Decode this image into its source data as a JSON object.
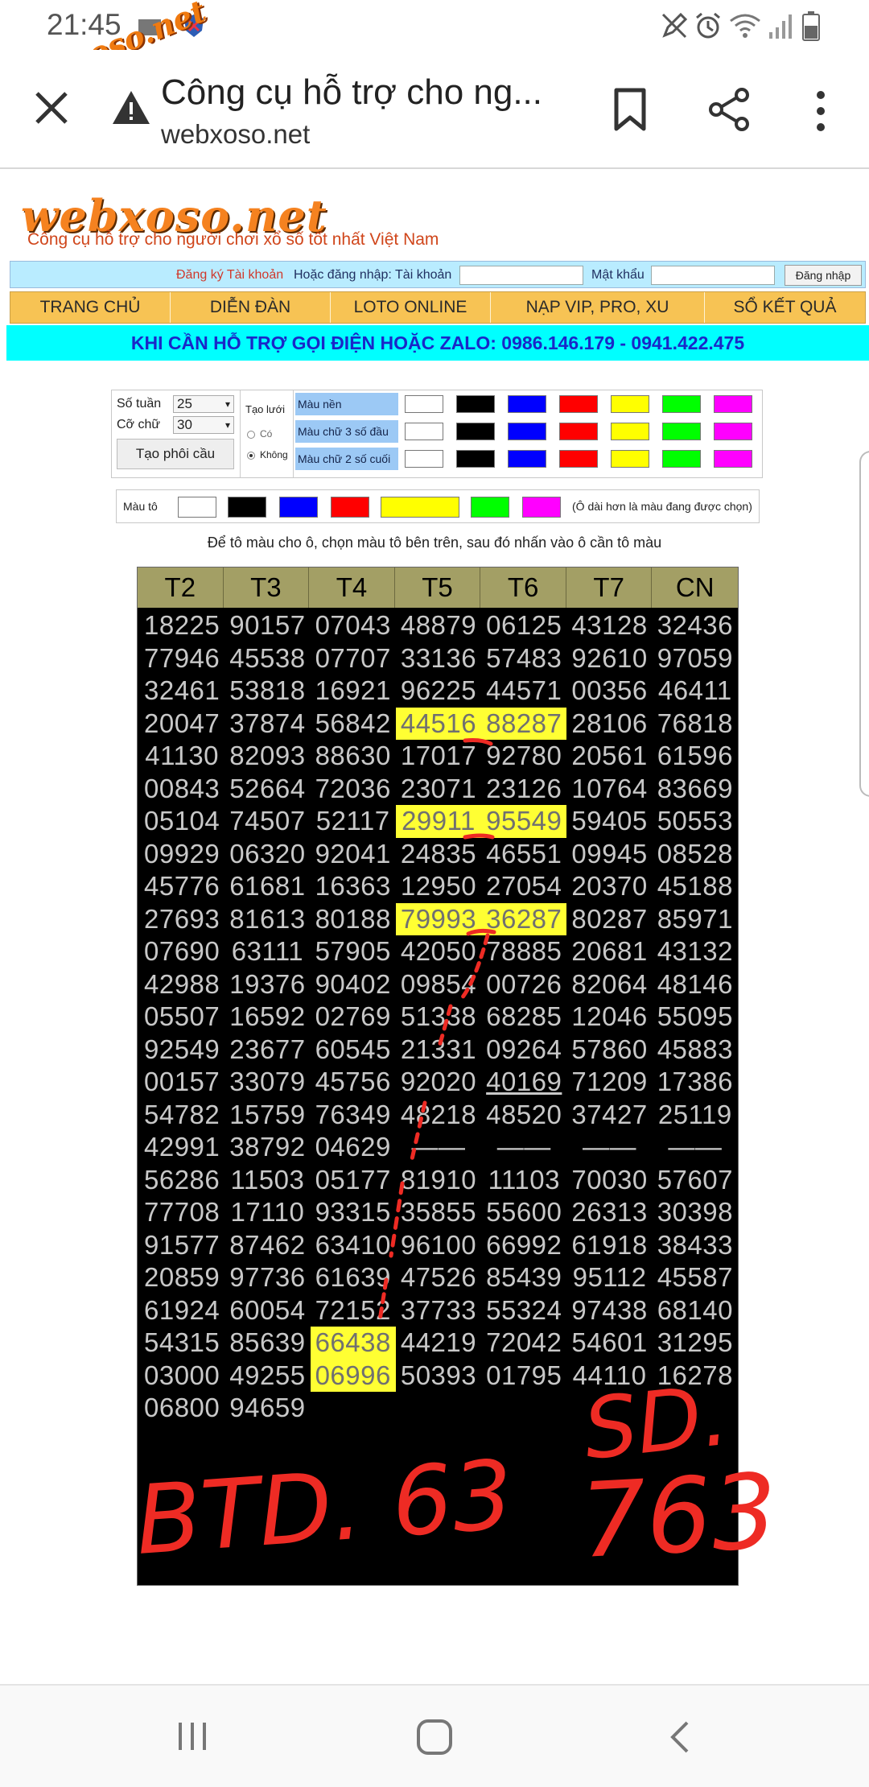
{
  "status_bar": {
    "time": "21:45"
  },
  "watermark": "webxoso.net",
  "browser": {
    "title": "Công cụ hỗ trợ cho ng...",
    "url": "webxoso.net"
  },
  "site": {
    "logo": "webxoso.net",
    "slogan": "Công cụ hỗ trợ cho người chơi xổ số tốt nhất Việt Nam",
    "register": "Đăng ký Tài khoản",
    "login_or": "Hoặc đăng nhập: Tài khoản",
    "password_label": "Mật khẩu",
    "login_button": "Đăng nhập",
    "nav": [
      "TRANG CHỦ",
      "DIỄN ĐÀN",
      "LOTO ONLINE",
      "NẠP VIP, PRO, XU",
      "SỔ KẾT QUẢ"
    ],
    "support": "KHI CẦN HỖ TRỢ GỌI ĐIỆN HOẶC ZALO: 0986.146.179 - 0941.422.475"
  },
  "settings": {
    "weeks_label": "Số tuần",
    "weeks_value": "25",
    "font_label": "Cỡ chữ",
    "font_value": "30",
    "create_button": "Tạo phôi cầu",
    "grid_label": "Tạo lưới",
    "grid_yes": "Có",
    "grid_no": "Không",
    "rows": [
      "Màu nền",
      "Màu chữ 3 số đầu",
      "Màu chữ 2 số cuối"
    ],
    "colors": [
      "#ffffff",
      "#000000",
      "#0000ff",
      "#ff0000",
      "#ffff00",
      "#00ff00",
      "#ff00ff"
    ]
  },
  "paint": {
    "label": "Màu tô",
    "note": "(Ô dài hơn là màu đang được chọn)"
  },
  "instruction": "Để tô màu cho ô, chọn màu tô bên trên, sau đó nhấn vào ô cần tô màu",
  "grid": {
    "headers": [
      "T2",
      "T3",
      "T4",
      "T5",
      "T6",
      "T7",
      "CN"
    ],
    "rows": [
      [
        "18225",
        "90157",
        "07043",
        "48879",
        "06125",
        "43128",
        "32436"
      ],
      [
        "77946",
        "45538",
        "07707",
        "33136",
        "57483",
        "92610",
        "97059"
      ],
      [
        "32461",
        "53818",
        "16921",
        "96225",
        "44571",
        "00356",
        "46411"
      ],
      [
        "20047",
        "37874",
        "56842",
        "44516",
        "88287",
        "28106",
        "76818"
      ],
      [
        "41130",
        "82093",
        "88630",
        "17017",
        "92780",
        "20561",
        "61596"
      ],
      [
        "00843",
        "52664",
        "72036",
        "23071",
        "23126",
        "10764",
        "83669"
      ],
      [
        "05104",
        "74507",
        "52117",
        "29911",
        "95549",
        "59405",
        "50553"
      ],
      [
        "09929",
        "06320",
        "92041",
        "24835",
        "46551",
        "09945",
        "08528"
      ],
      [
        "45776",
        "61681",
        "16363",
        "12950",
        "27054",
        "20370",
        "45188"
      ],
      [
        "27693",
        "81613",
        "80188",
        "79993",
        "36287",
        "80287",
        "85971"
      ],
      [
        "07690",
        "63111",
        "57905",
        "42050",
        "78885",
        "20681",
        "43132"
      ],
      [
        "42988",
        "19376",
        "90402",
        "09854",
        "00726",
        "82064",
        "48146"
      ],
      [
        "05507",
        "16592",
        "02769",
        "51338",
        "68285",
        "12046",
        "55095"
      ],
      [
        "92549",
        "23677",
        "60545",
        "21331",
        "09264",
        "57860",
        "45883"
      ],
      [
        "00157",
        "33079",
        "45756",
        "92020",
        "40169",
        "71209",
        "17386"
      ],
      [
        "54782",
        "15759",
        "76349",
        "48218",
        "48520",
        "37427",
        "25119"
      ],
      [
        "42991",
        "38792",
        "04629",
        "——",
        "——",
        "——",
        "——"
      ],
      [
        "56286",
        "11503",
        "05177",
        "81910",
        "11103",
        "70030",
        "57607"
      ],
      [
        "77708",
        "17110",
        "93315",
        "35855",
        "55600",
        "26313",
        "30398"
      ],
      [
        "91577",
        "87462",
        "63410",
        "96100",
        "66992",
        "61918",
        "38433"
      ],
      [
        "20859",
        "97736",
        "61639",
        "47526",
        "85439",
        "95112",
        "45587"
      ],
      [
        "61924",
        "60054",
        "72152",
        "37733",
        "55324",
        "97438",
        "68140"
      ],
      [
        "54315",
        "85639",
        "66438",
        "44219",
        "72042",
        "54601",
        "31295"
      ],
      [
        "03000",
        "49255",
        "06996",
        "50393",
        "01795",
        "44110",
        "16278"
      ],
      [
        "06800",
        "94659",
        "",
        "",
        "",
        "",
        ""
      ]
    ],
    "highlights": [
      "3-3",
      "3-4",
      "6-3",
      "6-4",
      "9-3",
      "9-4",
      "22-2",
      "23-2"
    ],
    "underlined": [
      "14-4"
    ]
  },
  "handwriting": {
    "left": "BTD. 63",
    "right_top": "SD.",
    "right_bottom": "763",
    "ink_color": "#ee2b24"
  }
}
